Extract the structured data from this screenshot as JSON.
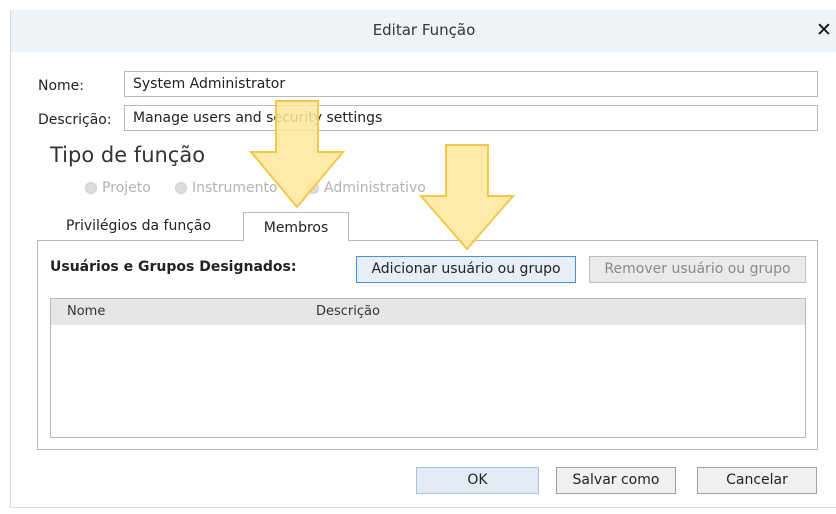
{
  "dialog": {
    "title": "Editar Função",
    "close_glyph": "✕"
  },
  "form": {
    "name_label": "Nome:",
    "name_value": "System Administrator",
    "description_label": "Descrição:",
    "description_value": "Manage users and security settings"
  },
  "role_type": {
    "heading": "Tipo de função",
    "options": [
      "Projeto",
      "Instrumento",
      "Administrativo"
    ],
    "selected": "Administrativo"
  },
  "tabs": [
    {
      "label": "Privilégios da função",
      "active": false
    },
    {
      "label": "Membros",
      "active": true
    }
  ],
  "members": {
    "label": "Usuários e Grupos Designados:",
    "add_button": "Adicionar usuário ou grupo",
    "remove_button": "Remover usuário ou grupo",
    "columns": [
      "Nome",
      "Descrição"
    ],
    "rows": []
  },
  "footer": {
    "ok": "OK",
    "save_as": "Salvar como",
    "cancel": "Cancelar"
  },
  "colors": {
    "titlebar": "#eef3f8",
    "highlight_arrow": "#fde79a",
    "primary_border": "#4a90d9"
  }
}
